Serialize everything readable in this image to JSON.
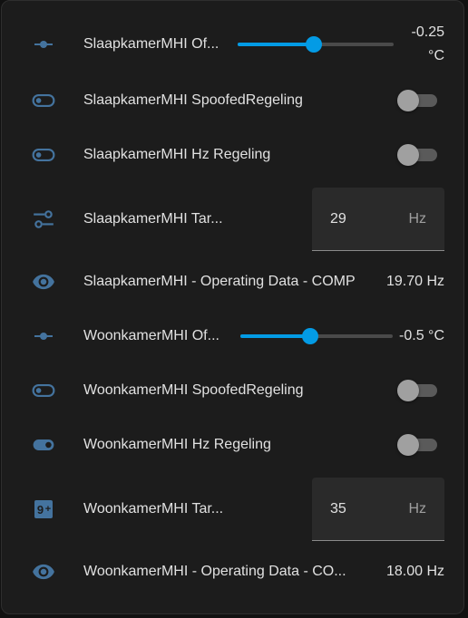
{
  "colors": {
    "icon": "#44739e",
    "accent": "#039be5",
    "card_bg": "#1c1c1c",
    "text": "#e1e1e1",
    "secondary_text": "#9e9e9e"
  },
  "rows": [
    {
      "type": "slider",
      "icon": "slider-horizontal-icon",
      "name": "SlaapkamerMHI Of...",
      "state_line1": "-0.25",
      "state_line2": "°C",
      "slider_fraction": 0.49
    },
    {
      "type": "toggle",
      "icon": "toggle-switch-off-icon",
      "name": "SlaapkamerMHI SpoofedRegeling",
      "on": false
    },
    {
      "type": "toggle",
      "icon": "toggle-switch-off-icon",
      "name": "SlaapkamerMHI Hz Regeling",
      "on": false
    },
    {
      "type": "number",
      "icon": "tune-icon",
      "name": "SlaapkamerMHI Tar...",
      "value": "29",
      "unit": "Hz"
    },
    {
      "type": "sensor",
      "icon": "eye-icon",
      "name": "SlaapkamerMHI - Operating Data - COMP",
      "state": "19.70 Hz"
    },
    {
      "type": "slider",
      "icon": "slider-horizontal-icon",
      "name": "WoonkamerMHI Of...",
      "state": "-0.5 °C",
      "slider_fraction": 0.46
    },
    {
      "type": "toggle",
      "icon": "toggle-switch-off-icon",
      "name": "WoonkamerMHI SpoofedRegeling",
      "on": false
    },
    {
      "type": "toggle",
      "icon": "toggle-switch-icon",
      "name": "WoonkamerMHI Hz Regeling",
      "on": false
    },
    {
      "type": "number",
      "icon": "numeric-9-plus-box-icon",
      "name": "WoonkamerMHI Tar...",
      "value": "35",
      "unit": "Hz"
    },
    {
      "type": "sensor",
      "icon": "eye-icon",
      "name": "WoonkamerMHI - Operating Data - CO...",
      "state": "18.00 Hz"
    }
  ]
}
